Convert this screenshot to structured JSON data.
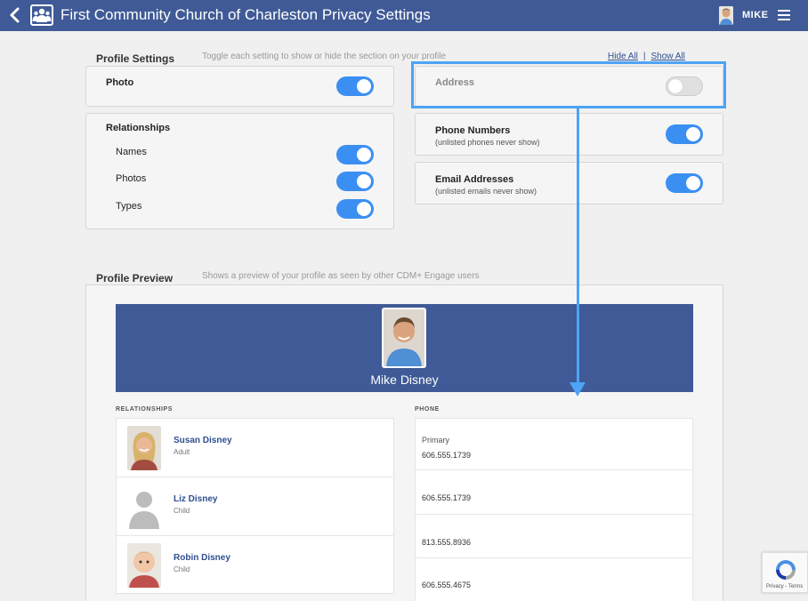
{
  "header": {
    "title": "First Community Church of Charleston  Privacy Settings",
    "user_name": "MIKE",
    "color": "#3f5a96"
  },
  "profile_settings": {
    "title": "Profile Settings",
    "hint": "Toggle each setting to show or hide the section on your profile",
    "hide_all": "Hide All",
    "separator": "|",
    "show_all": "Show All",
    "photo": {
      "label": "Photo",
      "on": true
    },
    "relationships": {
      "label": "Relationships",
      "items": [
        {
          "label": "Names",
          "on": true
        },
        {
          "label": "Photos",
          "on": true
        },
        {
          "label": "Types",
          "on": true
        }
      ]
    },
    "address": {
      "label": "Address",
      "on": false
    },
    "phone_numbers": {
      "label": "Phone Numbers",
      "sub": "(unlisted phones never show)",
      "on": true
    },
    "email_addresses": {
      "label": "Email Addresses",
      "sub": "(unlisted emails never show)",
      "on": true
    },
    "toggle_on_color": "#3b8ff2"
  },
  "profile_preview": {
    "title": "Profile Preview",
    "hint": "Shows a preview of your profile as seen by other CDM+ Engage users",
    "name": "Mike Disney",
    "relationships_heading": "RELATIONSHIPS",
    "phone_heading": "PHONE",
    "relationships": [
      {
        "name": "Susan Disney",
        "role": "Adult"
      },
      {
        "name": "Liz Disney",
        "role": "Child"
      },
      {
        "name": "Robin Disney",
        "role": "Child"
      }
    ],
    "phones": [
      {
        "label": "Primary",
        "number": "606.555.1739"
      },
      {
        "label": "",
        "number": "606.555.1739"
      },
      {
        "label": "",
        "number": "813.555.8936"
      },
      {
        "label": "",
        "number": "606.555.4675"
      }
    ]
  },
  "recaptcha": {
    "text": "Privacy - Terms"
  },
  "annotation_color": "#4da3f5"
}
